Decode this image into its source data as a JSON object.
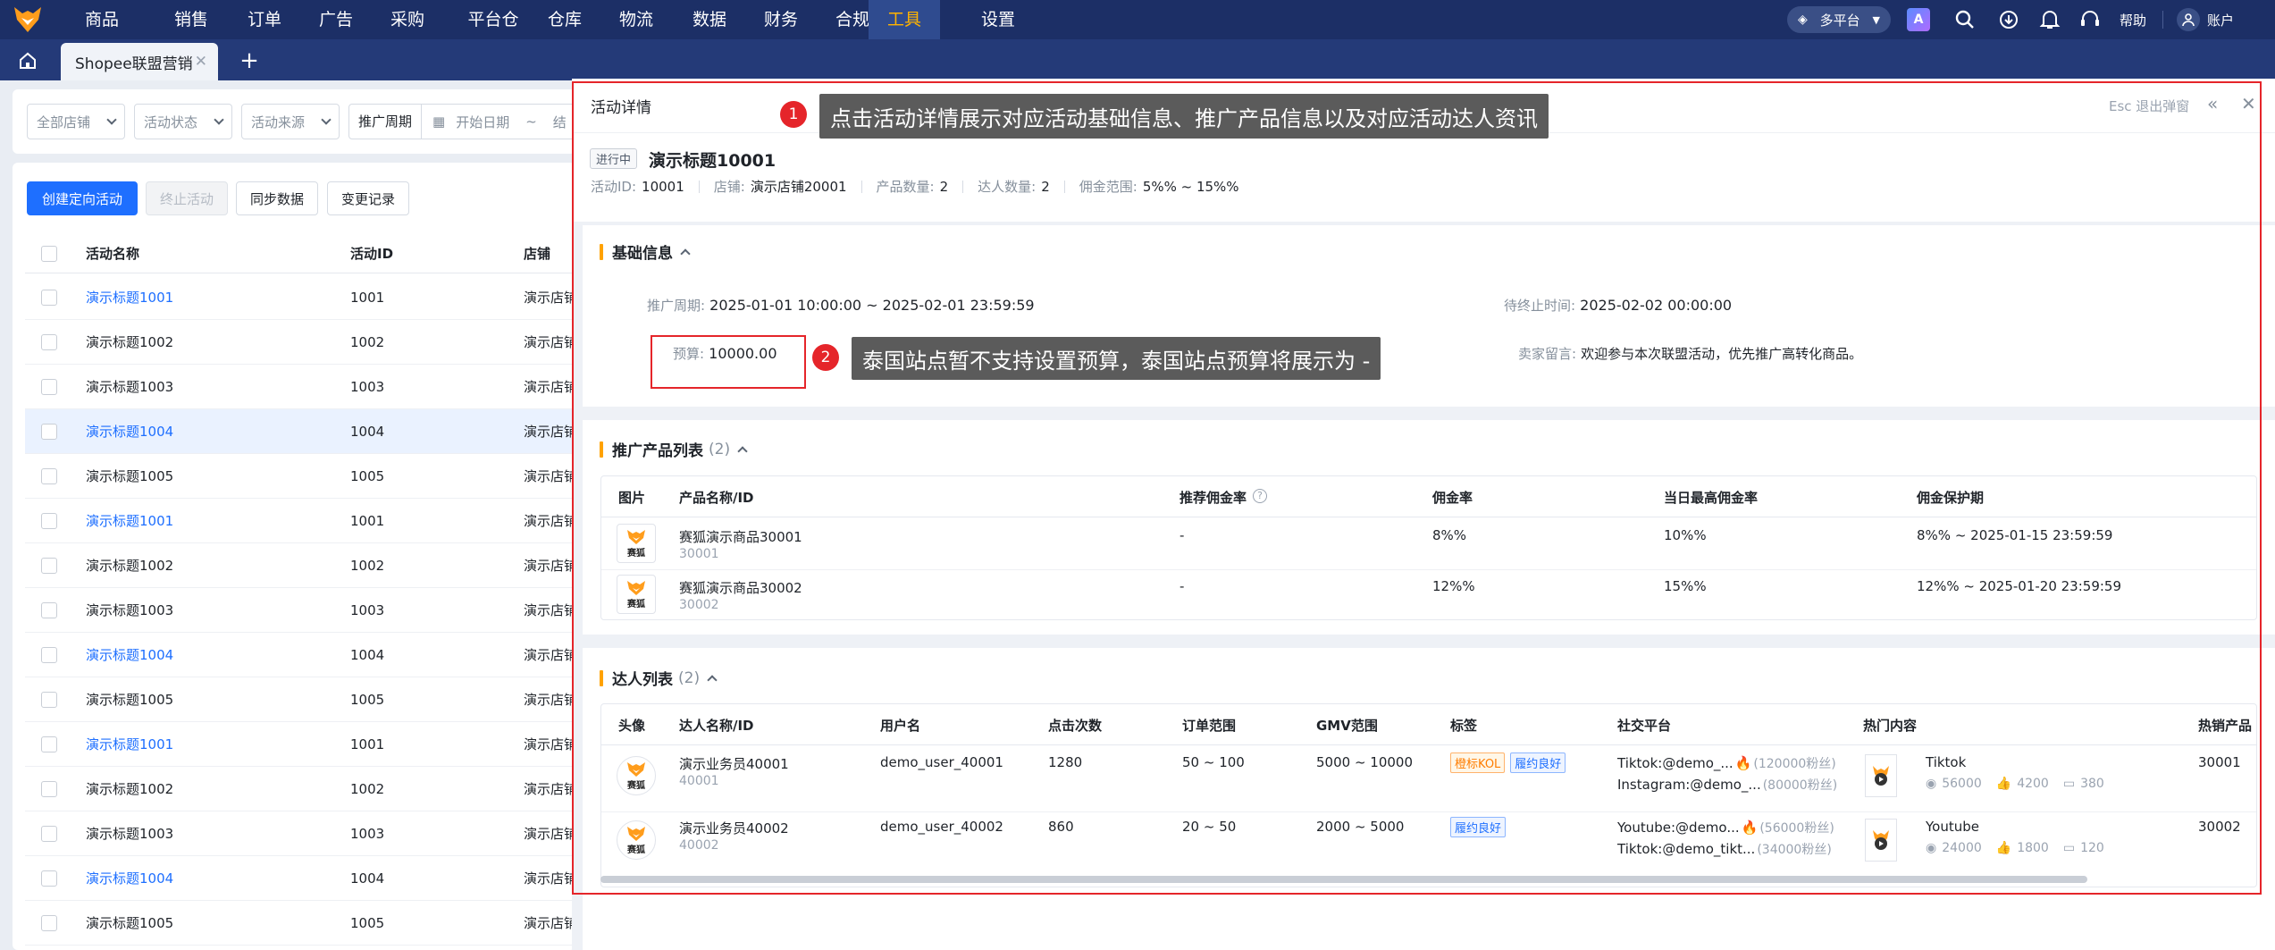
{
  "nav": {
    "menu": [
      "商品",
      "销售",
      "订单",
      "广告",
      "采购",
      "平台仓",
      "仓库",
      "物流",
      "数据",
      "财务",
      "合规",
      "工具",
      "设置"
    ],
    "active": "工具",
    "platform": "多平台",
    "help": "帮助",
    "account": "账户"
  },
  "tabs": {
    "current": "Shopee联盟营销"
  },
  "filters": {
    "shop": "全部店铺",
    "status": "活动状态",
    "source": "活动来源",
    "period_label": "推广周期",
    "start_date": "开始日期",
    "tilde": "~",
    "end_date_partial": "结"
  },
  "actions": {
    "create": "创建定向活动",
    "stop": "终止活动",
    "sync": "同步数据",
    "log": "变更记录"
  },
  "list": {
    "headers": [
      "活动名称",
      "活动ID",
      "店铺"
    ],
    "rows": [
      {
        "name": "演示标题1001",
        "id": "1001",
        "shop": "演示店铺",
        "link": true,
        "hl": false
      },
      {
        "name": "演示标题1002",
        "id": "1002",
        "shop": "演示店铺",
        "link": false,
        "hl": false
      },
      {
        "name": "演示标题1003",
        "id": "1003",
        "shop": "演示店铺",
        "link": false,
        "hl": false
      },
      {
        "name": "演示标题1004",
        "id": "1004",
        "shop": "演示店铺",
        "link": true,
        "hl": true
      },
      {
        "name": "演示标题1005",
        "id": "1005",
        "shop": "演示店铺",
        "link": false,
        "hl": false
      },
      {
        "name": "演示标题1001",
        "id": "1001",
        "shop": "演示店铺",
        "link": true,
        "hl": false
      },
      {
        "name": "演示标题1002",
        "id": "1002",
        "shop": "演示店铺",
        "link": false,
        "hl": false
      },
      {
        "name": "演示标题1003",
        "id": "1003",
        "shop": "演示店铺",
        "link": false,
        "hl": false
      },
      {
        "name": "演示标题1004",
        "id": "1004",
        "shop": "演示店铺",
        "link": true,
        "hl": false
      },
      {
        "name": "演示标题1005",
        "id": "1005",
        "shop": "演示店铺",
        "link": false,
        "hl": false
      },
      {
        "name": "演示标题1001",
        "id": "1001",
        "shop": "演示店铺",
        "link": true,
        "hl": false
      },
      {
        "name": "演示标题1002",
        "id": "1002",
        "shop": "演示店铺",
        "link": false,
        "hl": false
      },
      {
        "name": "演示标题1003",
        "id": "1003",
        "shop": "演示店铺",
        "link": false,
        "hl": false
      },
      {
        "name": "演示标题1004",
        "id": "1004",
        "shop": "演示店铺",
        "link": true,
        "hl": false
      },
      {
        "name": "演示标题1005",
        "id": "1005",
        "shop": "演示店铺",
        "link": false,
        "hl": false
      }
    ]
  },
  "drawer": {
    "title": "活动详情",
    "esc": "Esc 退出弹窗",
    "status_badge": "进行中",
    "activity_title": "演示标题10001",
    "meta": [
      {
        "label": "活动ID:",
        "value": "10001"
      },
      {
        "label": "店铺:",
        "value": "演示店铺20001"
      },
      {
        "label": "产品数量:",
        "value": "2"
      },
      {
        "label": "达人数量:",
        "value": "2"
      },
      {
        "label": "佣金范围:",
        "value": "5%% ~ 15%%"
      }
    ],
    "basic": {
      "title": "基础信息",
      "period_label": "推广周期:",
      "period_value": "2025-01-01 10:00:00 ~ 2025-02-01 23:59:59",
      "stop_label": "待终止时间:",
      "stop_value": "2025-02-02 00:00:00",
      "budget_label": "预算:",
      "budget_value": "10000.00",
      "msg_label": "卖家留言:",
      "msg_value": "欢迎参与本次联盟活动，优先推广高转化商品。"
    },
    "products": {
      "title": "推广产品列表",
      "count": "(2)",
      "headers": [
        "图片",
        "产品名称/ID",
        "推荐佣金率",
        "佣金率",
        "当日最高佣金率",
        "佣金保护期"
      ],
      "rows": [
        {
          "name": "赛狐演示商品30001",
          "id": "30001",
          "rec": "-",
          "rate": "8%%",
          "max": "10%%",
          "protect": "8%% ~ 2025-01-15 23:59:59"
        },
        {
          "name": "赛狐演示商品30002",
          "id": "30002",
          "rec": "-",
          "rate": "12%%",
          "max": "15%%",
          "protect": "12%% ~ 2025-01-20 23:59:59"
        }
      ],
      "img_text": "赛狐"
    },
    "creators": {
      "title": "达人列表",
      "count": "(2)",
      "headers": [
        "头像",
        "达人名称/ID",
        "用户名",
        "点击次数",
        "订单范围",
        "GMV范围",
        "标签",
        "社交平台",
        "热门内容",
        "热销产品"
      ],
      "rows": [
        {
          "name": "演示业务员40001",
          "id": "40001",
          "user": "demo_user_40001",
          "clicks": "1280",
          "orders": "50 ~ 100",
          "gmv": "5000 ~ 10000",
          "tags": [
            {
              "text": "橙标KOL",
              "style": "o"
            },
            {
              "text": "履约良好",
              "style": "b"
            }
          ],
          "social1": "Tiktok:@demo_...",
          "fans1": "(120000粉丝)",
          "social2": "Instagram:@demo_...",
          "fans2": "(80000粉丝)",
          "hot_platform": "Tiktok",
          "views": "56000",
          "likes": "4200",
          "comments": "380",
          "product": "30001"
        },
        {
          "name": "演示业务员40002",
          "id": "40002",
          "user": "demo_user_40002",
          "clicks": "860",
          "orders": "20 ~ 50",
          "gmv": "2000 ~ 5000",
          "tags": [
            {
              "text": "履约良好",
              "style": "b"
            }
          ],
          "social1": "Youtube:@demo...",
          "fans1": "(56000粉丝)",
          "social2": "Tiktok:@demo_tikt...",
          "fans2": "(34000粉丝)",
          "hot_platform": "Youtube",
          "views": "24000",
          "likes": "1800",
          "comments": "120",
          "product": "30002"
        }
      ]
    }
  },
  "callouts": {
    "n1": "1",
    "t1": "点击活动详情展示对应活动基础信息、推广产品信息以及对应活动达人资讯",
    "n2": "2",
    "t2": "泰国站点暂不支持设置预算，泰国站点预算将展示为 -"
  },
  "colors": {
    "nav": "#1c2f66",
    "accent": "#1e6fff",
    "active_menu": "#ffb300",
    "callout_red": "#e5252a",
    "section_bar": "#ffa200"
  }
}
